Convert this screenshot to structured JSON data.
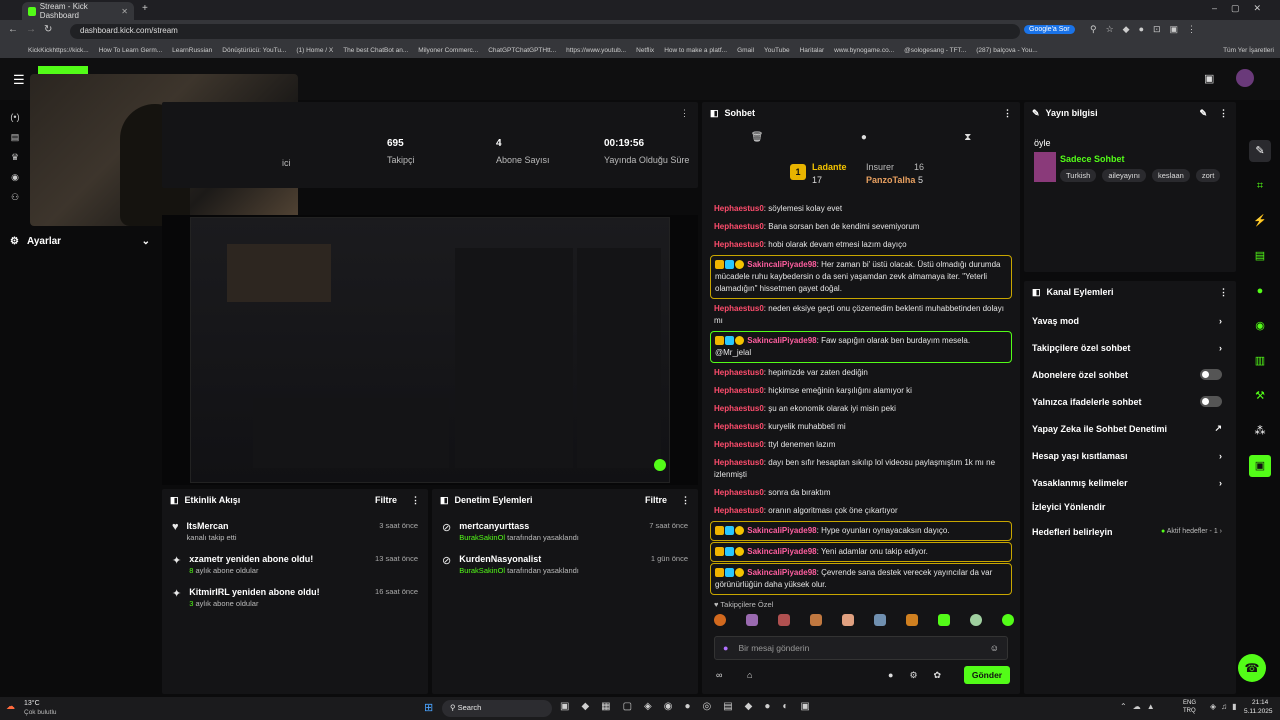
{
  "browser": {
    "tab_title": "Stream - Kick Dashboard",
    "url": "dashboard.kick.com/stream",
    "google_btn": "Google'a Sor",
    "bookmarks": [
      "KickKickhttps://kick...",
      "How To Learn Germ...",
      "LearnRussian",
      "Dönüştürücü: YouTu...",
      "(1) Home / X",
      "The best ChatBot an...",
      "Milyoner Commerc...",
      "ChatGPTChatGPTHtt...",
      "https://www.youtub...",
      "Netflix",
      "How to make a platf...",
      "Gmail",
      "YouTube",
      "Haritalar",
      "www.bynogame.co...",
      "@sologesang - TFT...",
      "(287) balçova - You...",
      "Tüm Yer İşaretleri"
    ]
  },
  "stats": [
    {
      "value": "",
      "label": "ici"
    },
    {
      "value": "695",
      "label": "Takipçi"
    },
    {
      "value": "4",
      "label": "Abone Sayısı"
    },
    {
      "value": "00:19:56",
      "label": "Yayında Olduğu Süre"
    }
  ],
  "sidenav": {
    "settings_label": "Ayarlar"
  },
  "activity": {
    "title": "Etkinlik Akışı",
    "filter": "Filtre",
    "items": [
      {
        "title": "ItsMercan",
        "sub": "kanalı takip etti",
        "highlight": "",
        "time": "3 saat önce"
      },
      {
        "title": "xzametr yeniden abone oldu!",
        "highlight": "8",
        "sub": "aylık abone oldular",
        "time": "13 saat önce"
      },
      {
        "title": "KitmirIRL yeniden abone oldu!",
        "highlight": "3",
        "sub": "aylık abone oldular",
        "time": "16 saat önce"
      }
    ]
  },
  "moderation": {
    "title": "Denetim Eylemleri",
    "filter": "Filtre",
    "items": [
      {
        "title": "mertcanyurttass",
        "mod": "BurakSakinOl",
        "sub": "tarafından yasaklandı",
        "time": "7 saat önce"
      },
      {
        "title": "KurdenNasyonalist",
        "mod": "BurakSakinOl",
        "sub": "tarafından yasaklandı",
        "time": "1 gün önce"
      }
    ]
  },
  "chat": {
    "title": "Sohbet",
    "leaderboard": {
      "first_name": "Ladante",
      "first_count": "17",
      "second_name": "Insurer",
      "second_count": "16",
      "third_name": "PanzoTalha",
      "third_count": "5",
      "rank": "1"
    },
    "messages": [
      {
        "user": "Hephaestus0",
        "text": "söylemesi kolay evet",
        "style": ""
      },
      {
        "user": "Hephaestus0",
        "text": "Bana sorsan ben de kendimi sevemiyorum",
        "style": ""
      },
      {
        "user": "Hephaestus0",
        "text": "hobi olarak devam etmesi lazım dayıço",
        "style": ""
      },
      {
        "user": "SakincaliPiyade98",
        "text": "Her zaman bi' üstü olacak. Üstü olmadığı durumda mücadele ruhu kaybedersin o da seni yaşamdan zevk almamaya iter. \"Yeterli olamadığın\" hissetmen gayet doğal.",
        "style": "hl"
      },
      {
        "user": "Hephaestus0",
        "text": "neden eksiye geçti onu çözemedim beklenti muhabbetinden dolayı mı",
        "style": ""
      },
      {
        "user": "SakincaliPiyade98",
        "text": "Faw sapığın olarak ben burdayım mesela. @Mr_jelal",
        "style": "hl2"
      },
      {
        "user": "Hephaestus0",
        "text": "hepimizde var zaten dediğin",
        "style": ""
      },
      {
        "user": "Hephaestus0",
        "text": "hiçkimse emeğinin karşılığını alamıyor ki",
        "style": ""
      },
      {
        "user": "Hephaestus0",
        "text": "şu an ekonomik olarak iyi misin peki",
        "style": ""
      },
      {
        "user": "Hephaestus0",
        "text": "kuryelik muhabbeti mi",
        "style": ""
      },
      {
        "user": "Hephaestus0",
        "text": "ttyl denemen lazım",
        "style": ""
      },
      {
        "user": "Hephaestus0",
        "text": "dayı ben sıfır hesaptan sıkılıp lol videosu paylaşmıştım 1k mı ne izlenmişti",
        "style": ""
      },
      {
        "user": "Hephaestus0",
        "text": "sonra da bıraktım",
        "style": ""
      },
      {
        "user": "Hephaestus0",
        "text": "oranın algoritması çok öne çıkartıyor",
        "style": ""
      },
      {
        "user": "SakincaliPiyade98",
        "text": "Hype oyunları oynayacaksın dayıço.",
        "style": "hl"
      },
      {
        "user": "SakincaliPiyade98",
        "text": "Yeni adamlar onu takip ediyor.",
        "style": "hl"
      },
      {
        "user": "SakincaliPiyade98",
        "text": "Çevrende sana destek verecek yayıncılar da var görünürlüğün daha yüksek olur.",
        "style": "hl"
      }
    ],
    "followers_only": "Takipçilere Özel",
    "placeholder": "Bir mesaj gönderin",
    "send": "Gönder"
  },
  "stream_info": {
    "title": "Yayın bilgisi",
    "stream_title": "öyle",
    "category": "Sadece Sohbet",
    "tags": [
      "Turkish",
      "aileyayını",
      "keslaan",
      "zort"
    ]
  },
  "channel_actions": {
    "title": "Kanal Eylemleri",
    "rows": [
      {
        "label": "Yavaş mod",
        "control": "chevron"
      },
      {
        "label": "Takipçilere özel sohbet",
        "control": "chevron"
      },
      {
        "label": "Abonelere özel sohbet",
        "control": "toggle"
      },
      {
        "label": "Yalnızca ifadelerle sohbet",
        "control": "toggle"
      },
      {
        "label": "Yapay Zeka ile Sohbet Denetimi",
        "control": "external"
      },
      {
        "label": "Hesap yaşı kısıtlaması",
        "control": "chevron"
      },
      {
        "label": "Yasaklanmış kelimeler",
        "control": "chevron"
      },
      {
        "label": "İzleyici Yönlendir",
        "control": "none"
      },
      {
        "label": "Hedefleri belirleyin",
        "control": "goal"
      }
    ],
    "goal_status": "Aktif hedefler - 1"
  },
  "taskbar": {
    "weather_temp": "13°C",
    "weather_desc": "Çok bulutlu",
    "search": "Search",
    "lang1": "ENG",
    "lang2": "TRQ",
    "time": "21:14",
    "date": "5.11.2025"
  },
  "colors": {
    "accent": "#53fc18",
    "username": "#ff4d6d",
    "vip": "#ff5fa0",
    "highlight_border": "#c8a600"
  }
}
